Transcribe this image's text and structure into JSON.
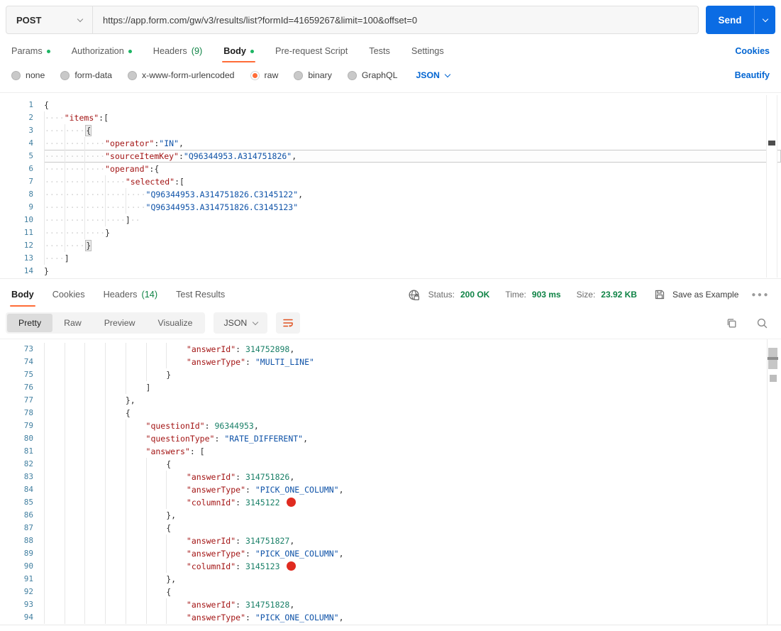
{
  "request": {
    "method": "POST",
    "url": "https://app.form.com/gw/v3/results/list?formId=41659267&limit=100&offset=0",
    "send_label": "Send",
    "cookies_link": "Cookies",
    "tabs": [
      {
        "label": "Params",
        "dot": true
      },
      {
        "label": "Authorization",
        "dot": true
      },
      {
        "label": "Headers",
        "count": "(9)"
      },
      {
        "label": "Body",
        "dot": true,
        "active": true
      },
      {
        "label": "Pre-request Script"
      },
      {
        "label": "Tests"
      },
      {
        "label": "Settings"
      }
    ],
    "body_type": {
      "options": [
        {
          "label": "none"
        },
        {
          "label": "form-data"
        },
        {
          "label": "x-www-form-urlencoded"
        },
        {
          "label": "raw",
          "selected": true
        },
        {
          "label": "binary"
        },
        {
          "label": "GraphQL"
        }
      ],
      "language": "JSON",
      "beautify_link": "Beautify"
    },
    "editor_lines": [
      {
        "no": 1,
        "indent": 0,
        "tokens": [
          {
            "t": "punc",
            "v": "{"
          }
        ]
      },
      {
        "no": 2,
        "indent": 1,
        "tokens": [
          {
            "t": "key",
            "v": "\"items\""
          },
          {
            "t": "punc",
            "v": ":["
          }
        ]
      },
      {
        "no": 3,
        "indent": 2,
        "tokens": [
          {
            "t": "punc",
            "v": "{",
            "box": true
          }
        ]
      },
      {
        "no": 4,
        "indent": 3,
        "tokens": [
          {
            "t": "key",
            "v": "\"operator\""
          },
          {
            "t": "punc",
            "v": ":"
          },
          {
            "t": "str",
            "v": "\"IN\""
          },
          {
            "t": "punc",
            "v": ","
          }
        ]
      },
      {
        "no": 5,
        "indent": 3,
        "active": true,
        "tokens": [
          {
            "t": "key",
            "v": "\"sourceItemKey\""
          },
          {
            "t": "punc",
            "v": ":"
          },
          {
            "t": "str",
            "v": "\"Q96344953.A314751826\""
          },
          {
            "t": "punc",
            "v": ","
          }
        ]
      },
      {
        "no": 6,
        "indent": 3,
        "tokens": [
          {
            "t": "key",
            "v": "\"operand\""
          },
          {
            "t": "punc",
            "v": ":{"
          }
        ]
      },
      {
        "no": 7,
        "indent": 4,
        "tokens": [
          {
            "t": "key",
            "v": "\"selected\""
          },
          {
            "t": "punc",
            "v": ":["
          }
        ]
      },
      {
        "no": 8,
        "indent": 5,
        "tokens": [
          {
            "t": "str",
            "v": "\"Q96344953.A314751826.C3145122\""
          },
          {
            "t": "punc",
            "v": ","
          }
        ]
      },
      {
        "no": 9,
        "indent": 5,
        "tokens": [
          {
            "t": "str",
            "v": "\"Q96344953.A314751826.C3145123\""
          }
        ]
      },
      {
        "no": 10,
        "indent": 4,
        "tokens": [
          {
            "t": "punc",
            "v": "]"
          },
          {
            "t": "dots",
            "v": "··"
          }
        ]
      },
      {
        "no": 11,
        "indent": 3,
        "tokens": [
          {
            "t": "punc",
            "v": "}"
          }
        ]
      },
      {
        "no": 12,
        "indent": 2,
        "tokens": [
          {
            "t": "punc",
            "v": "}",
            "box": true
          }
        ]
      },
      {
        "no": 13,
        "indent": 1,
        "tokens": [
          {
            "t": "punc",
            "v": "]"
          }
        ]
      },
      {
        "no": 14,
        "indent": 0,
        "tokens": [
          {
            "t": "punc",
            "v": "}"
          }
        ]
      }
    ]
  },
  "response": {
    "tabs": [
      {
        "label": "Body",
        "active": true
      },
      {
        "label": "Cookies"
      },
      {
        "label": "Headers",
        "count": "(14)"
      },
      {
        "label": "Test Results"
      }
    ],
    "meta": {
      "status_label": "Status:",
      "status_value": "200 OK",
      "time_label": "Time:",
      "time_value": "903 ms",
      "size_label": "Size:",
      "size_value": "23.92 KB",
      "save_as_example": "Save as Example"
    },
    "view_tabs": [
      {
        "label": "Pretty",
        "active": true
      },
      {
        "label": "Raw"
      },
      {
        "label": "Preview"
      },
      {
        "label": "Visualize"
      }
    ],
    "language": "JSON",
    "editor_lines": [
      {
        "no": 73,
        "indent": 7,
        "tokens": [
          {
            "t": "key",
            "v": "\"answerId\""
          },
          {
            "t": "punc",
            "v": ": "
          },
          {
            "t": "num",
            "v": "314752898"
          },
          {
            "t": "punc",
            "v": ","
          }
        ]
      },
      {
        "no": 74,
        "indent": 7,
        "tokens": [
          {
            "t": "key",
            "v": "\"answerType\""
          },
          {
            "t": "punc",
            "v": ": "
          },
          {
            "t": "str",
            "v": "\"MULTI_LINE\""
          }
        ]
      },
      {
        "no": 75,
        "indent": 6,
        "tokens": [
          {
            "t": "punc",
            "v": "}"
          }
        ]
      },
      {
        "no": 76,
        "indent": 5,
        "tokens": [
          {
            "t": "punc",
            "v": "]"
          }
        ]
      },
      {
        "no": 77,
        "indent": 4,
        "tokens": [
          {
            "t": "punc",
            "v": "},"
          }
        ]
      },
      {
        "no": 78,
        "indent": 4,
        "tokens": [
          {
            "t": "punc",
            "v": "{"
          }
        ]
      },
      {
        "no": 79,
        "indent": 5,
        "tokens": [
          {
            "t": "key",
            "v": "\"questionId\""
          },
          {
            "t": "punc",
            "v": ": "
          },
          {
            "t": "num",
            "v": "96344953"
          },
          {
            "t": "punc",
            "v": ","
          }
        ]
      },
      {
        "no": 80,
        "indent": 5,
        "tokens": [
          {
            "t": "key",
            "v": "\"questionType\""
          },
          {
            "t": "punc",
            "v": ": "
          },
          {
            "t": "str",
            "v": "\"RATE_DIFFERENT\""
          },
          {
            "t": "punc",
            "v": ","
          }
        ]
      },
      {
        "no": 81,
        "indent": 5,
        "tokens": [
          {
            "t": "key",
            "v": "\"answers\""
          },
          {
            "t": "punc",
            "v": ": ["
          }
        ]
      },
      {
        "no": 82,
        "indent": 6,
        "tokens": [
          {
            "t": "punc",
            "v": "{"
          }
        ]
      },
      {
        "no": 83,
        "indent": 7,
        "tokens": [
          {
            "t": "key",
            "v": "\"answerId\""
          },
          {
            "t": "punc",
            "v": ": "
          },
          {
            "t": "num",
            "v": "314751826"
          },
          {
            "t": "punc",
            "v": ","
          }
        ]
      },
      {
        "no": 84,
        "indent": 7,
        "tokens": [
          {
            "t": "key",
            "v": "\"answerType\""
          },
          {
            "t": "punc",
            "v": ": "
          },
          {
            "t": "str",
            "v": "\"PICK_ONE_COLUMN\""
          },
          {
            "t": "punc",
            "v": ","
          }
        ]
      },
      {
        "no": 85,
        "indent": 7,
        "marker": "red-dot",
        "tokens": [
          {
            "t": "key",
            "v": "\"columnId\""
          },
          {
            "t": "punc",
            "v": ": "
          },
          {
            "t": "num",
            "v": "3145122"
          }
        ]
      },
      {
        "no": 86,
        "indent": 6,
        "tokens": [
          {
            "t": "punc",
            "v": "},"
          }
        ]
      },
      {
        "no": 87,
        "indent": 6,
        "tokens": [
          {
            "t": "punc",
            "v": "{"
          }
        ]
      },
      {
        "no": 88,
        "indent": 7,
        "tokens": [
          {
            "t": "key",
            "v": "\"answerId\""
          },
          {
            "t": "punc",
            "v": ": "
          },
          {
            "t": "num",
            "v": "314751827"
          },
          {
            "t": "punc",
            "v": ","
          }
        ]
      },
      {
        "no": 89,
        "indent": 7,
        "tokens": [
          {
            "t": "key",
            "v": "\"answerType\""
          },
          {
            "t": "punc",
            "v": ": "
          },
          {
            "t": "str",
            "v": "\"PICK_ONE_COLUMN\""
          },
          {
            "t": "punc",
            "v": ","
          }
        ]
      },
      {
        "no": 90,
        "indent": 7,
        "marker": "red-dot",
        "tokens": [
          {
            "t": "key",
            "v": "\"columnId\""
          },
          {
            "t": "punc",
            "v": ": "
          },
          {
            "t": "num",
            "v": "3145123"
          }
        ]
      },
      {
        "no": 91,
        "indent": 6,
        "tokens": [
          {
            "t": "punc",
            "v": "},"
          }
        ]
      },
      {
        "no": 92,
        "indent": 6,
        "tokens": [
          {
            "t": "punc",
            "v": "{"
          }
        ]
      },
      {
        "no": 93,
        "indent": 7,
        "tokens": [
          {
            "t": "key",
            "v": "\"answerId\""
          },
          {
            "t": "punc",
            "v": ": "
          },
          {
            "t": "num",
            "v": "314751828"
          },
          {
            "t": "punc",
            "v": ","
          }
        ]
      },
      {
        "no": 94,
        "indent": 7,
        "tokens": [
          {
            "t": "key",
            "v": "\"answerType\""
          },
          {
            "t": "punc",
            "v": ": "
          },
          {
            "t": "str",
            "v": "\"PICK_ONE_COLUMN\""
          },
          {
            "t": "punc",
            "v": ","
          }
        ]
      }
    ]
  },
  "colors": {
    "accent_orange": "#FF6C37",
    "link_blue": "#0265D2",
    "send_blue": "#0B6CE4",
    "success_green": "#0E8345",
    "dot_green": "#1DB564",
    "code_key": "#A31515",
    "code_string": "#0F53A8",
    "code_number": "#1A8068",
    "red_marker": "#E02B20"
  }
}
